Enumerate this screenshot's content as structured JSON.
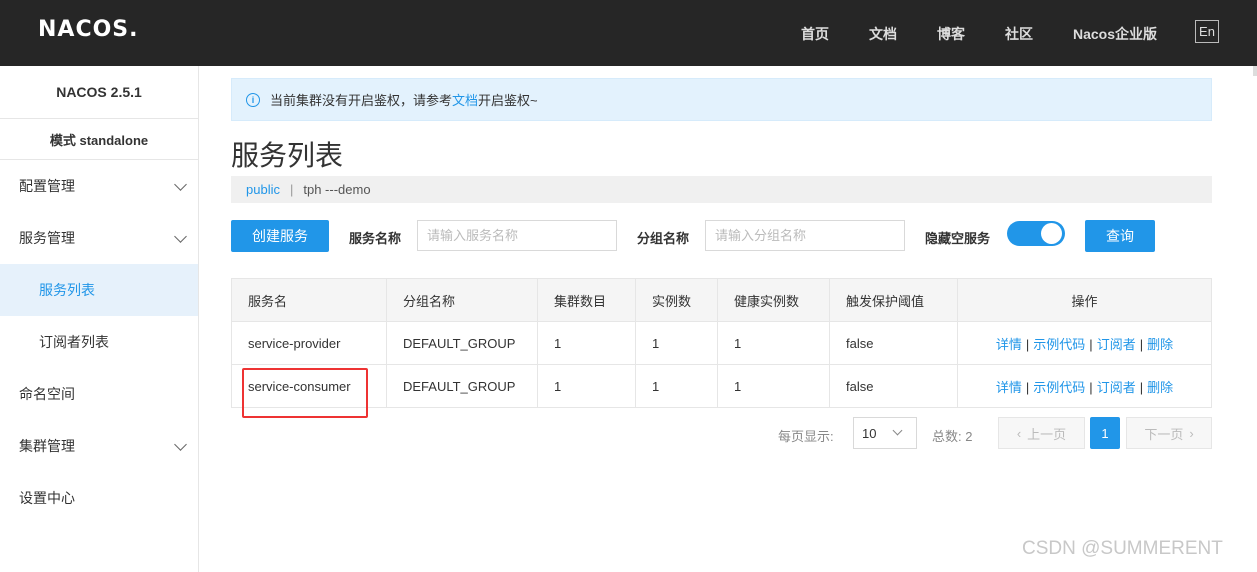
{
  "header": {
    "logo": "NACOS.",
    "nav": [
      {
        "label": "首页"
      },
      {
        "label": "文档"
      },
      {
        "label": "博客"
      },
      {
        "label": "社区"
      },
      {
        "label": "Nacos企业版"
      }
    ],
    "lang": "En"
  },
  "sidebar": {
    "version": "NACOS 2.5.1",
    "mode": "模式 standalone",
    "items": [
      {
        "label": "配置管理"
      },
      {
        "label": "服务管理"
      },
      {
        "label": "服务列表"
      },
      {
        "label": "订阅者列表"
      },
      {
        "label": "命名空间"
      },
      {
        "label": "集群管理"
      },
      {
        "label": "设置中心"
      }
    ]
  },
  "alert": {
    "before": "当前集群没有开启鉴权，请参考",
    "link": "文档",
    "after": "开启鉴权~"
  },
  "page_title": "服务列表",
  "breadcrumb": {
    "namespace": "public",
    "separator": "|",
    "current": "tph ---demo"
  },
  "toolbar": {
    "create_button": "创建服务",
    "service_name_label": "服务名称",
    "service_name_placeholder": "请输入服务名称",
    "group_name_label": "分组名称",
    "group_name_placeholder": "请输入分组名称",
    "hide_empty_label": "隐藏空服务",
    "hide_empty_enabled": true,
    "query_button": "查询"
  },
  "table": {
    "headers": [
      "服务名",
      "分组名称",
      "集群数目",
      "实例数",
      "健康实例数",
      "触发保护阈值",
      "操作"
    ],
    "rows": [
      [
        "service-provider",
        "DEFAULT_GROUP",
        "1",
        "1",
        "1",
        "false"
      ],
      [
        "service-consumer",
        "DEFAULT_GROUP",
        "1",
        "1",
        "1",
        "false"
      ]
    ],
    "actions": [
      "详情",
      "示例代码",
      "订阅者",
      "删除"
    ]
  },
  "pagination": {
    "per_page_label": "每页显示:",
    "per_page_value": "10",
    "total_label": "总数: 2",
    "prev": "上一页",
    "current": "1",
    "next": "下一页"
  },
  "watermark": "CSDN @SUMMERENT",
  "colors": {
    "accent": "#2196e8",
    "header_bg": "#262626",
    "highlight": "#ee3333"
  }
}
